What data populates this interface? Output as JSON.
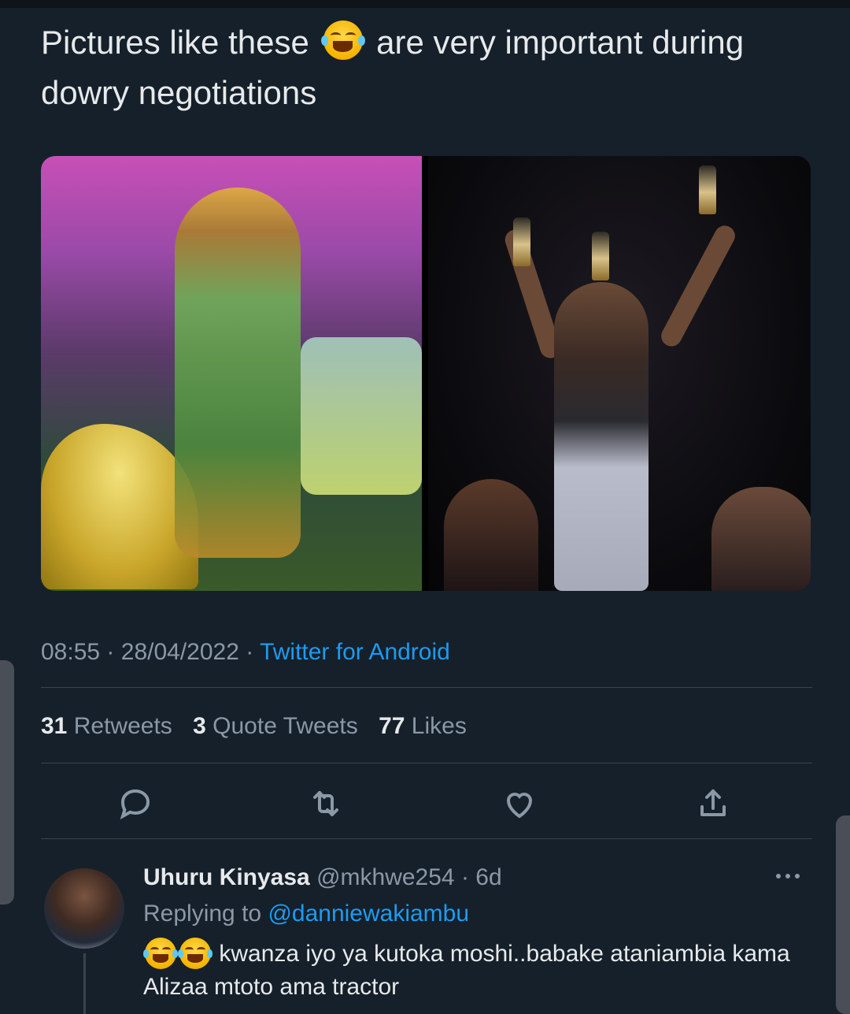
{
  "tweet": {
    "text_before": "Pictures like these",
    "emoji": "face-with-tears-of-joy",
    "text_after": "are very important during dowry negotiations",
    "time": "08:55",
    "date": "28/04/2022",
    "source": "Twitter for Android",
    "separator": "·"
  },
  "stats": {
    "retweets_count": "31",
    "retweets_label": "Retweets",
    "quotes_count": "3",
    "quotes_label": "Quote Tweets",
    "likes_count": "77",
    "likes_label": "Likes"
  },
  "actions": [
    "reply-icon",
    "retweet-icon",
    "like-icon",
    "share-icon"
  ],
  "reply": {
    "name": "Uhuru Kinyasa",
    "handle": "@mkhwe254",
    "age": "6d",
    "replying_prefix": "Replying to",
    "replying_to": "@danniewakiambu",
    "text": "kwanza iyo ya kutoka moshi..babake ataniambia kama Alizaa mtoto ama tractor"
  },
  "colors": {
    "background": "#15202b",
    "text": "#e7e9ea",
    "secondary": "#8b98a5",
    "accent": "#1d9bf0"
  }
}
